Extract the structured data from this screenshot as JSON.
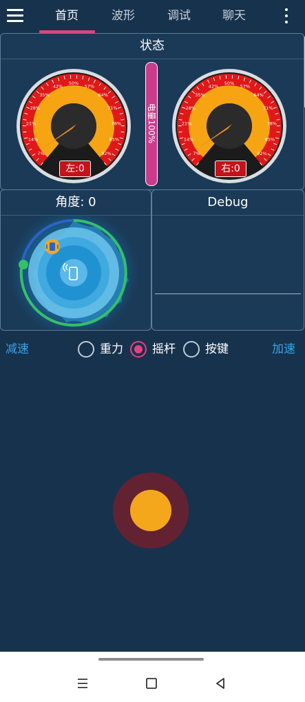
{
  "tabs": [
    {
      "label": "首页",
      "active": true
    },
    {
      "label": "波形",
      "active": false
    },
    {
      "label": "调试",
      "active": false
    },
    {
      "label": "聊天",
      "active": false
    }
  ],
  "status": {
    "title": "状态",
    "left_gauge_label": "左:0",
    "right_gauge_label": "右:0",
    "gauge_ticks": [
      "7%",
      "14%",
      "21%",
      "28%",
      "35%",
      "42%",
      "50%",
      "57%",
      "64%",
      "71%",
      "78%",
      "85%",
      "92%"
    ],
    "battery_label": "电量100%",
    "battery_level": 1.0
  },
  "angle": {
    "title": "角度:  0"
  },
  "debug": {
    "title": "Debug"
  },
  "controls": {
    "slow_label": "减速",
    "fast_label": "加速",
    "modes": [
      {
        "label": "重力",
        "checked": false
      },
      {
        "label": "摇杆",
        "checked": true
      },
      {
        "label": "按键",
        "checked": false
      }
    ]
  },
  "colors": {
    "background": "#17324d",
    "accent": "#e0447b",
    "link": "#38a3e8",
    "joystick_knob": "#f5a71c",
    "joystick_base": "#632232"
  },
  "icons": [
    "menu-icon",
    "more-vert-icon",
    "phone-wifi-icon",
    "vibrate-icon",
    "recent-apps-icon",
    "home-icon",
    "back-icon"
  ]
}
